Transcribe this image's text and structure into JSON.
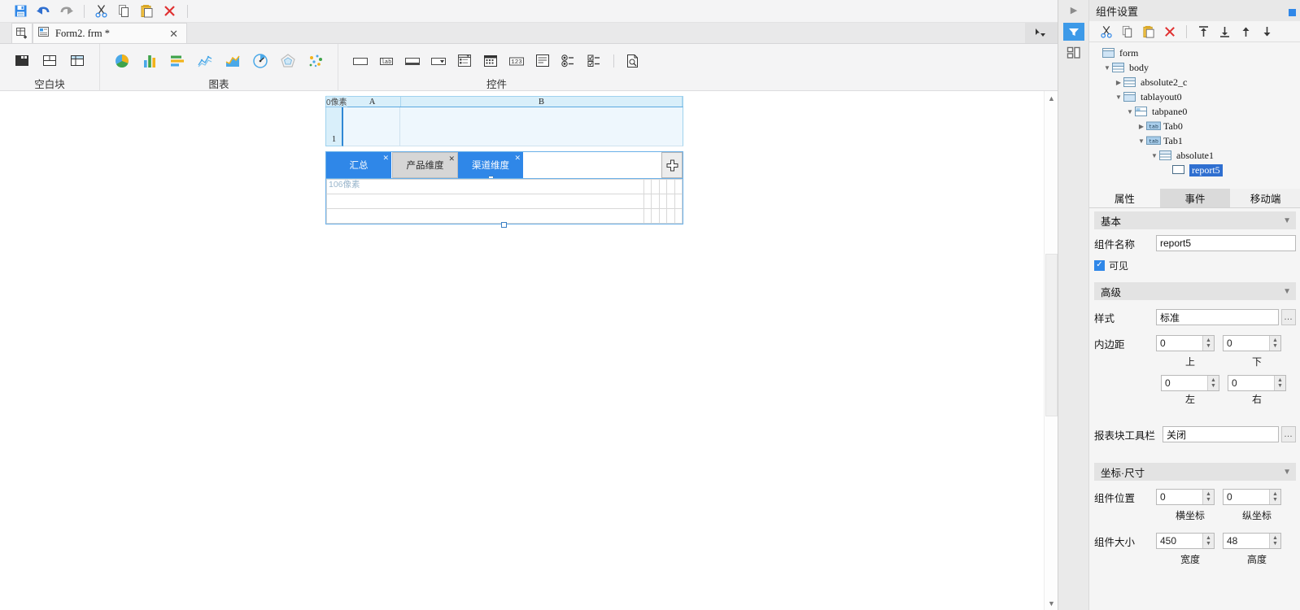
{
  "quick_toolbar": {
    "buttons": [
      {
        "name": "save-button",
        "icon": "save-icon",
        "label": "保存"
      },
      {
        "name": "undo-button",
        "icon": "undo-arrow-icon",
        "label": "撤销"
      },
      {
        "name": "redo-button",
        "icon": "redo-arrow-icon",
        "label": "重做"
      },
      {
        "name": "cut-button",
        "icon": "scissors-icon",
        "label": "剪切"
      },
      {
        "name": "copy-button",
        "icon": "copy-icon",
        "label": "复制"
      },
      {
        "name": "paste-button",
        "icon": "paste-icon",
        "label": "粘贴"
      },
      {
        "name": "delete-button",
        "icon": "red-x-icon",
        "label": "删除"
      }
    ]
  },
  "doc_tabs": {
    "grid_button_icon": "grid-plus-icon",
    "tabs": [
      {
        "label": "Form2. frm *",
        "icon": "form-document-icon",
        "close": "✕",
        "active": true
      }
    ],
    "right_icon": "cursor-dropdown-icon"
  },
  "ribbon": {
    "groups": [
      {
        "title": "空白块",
        "caret": "",
        "icons": [
          {
            "name": "block-solid-icon",
            "label": "空白块"
          },
          {
            "name": "block-split-horizontal-icon",
            "label": "横向分块"
          },
          {
            "name": "block-split-grid-icon",
            "label": "网格分块"
          }
        ]
      },
      {
        "title": "图表",
        "caret": "⌄",
        "icons": [
          {
            "name": "pie-chart-icon",
            "label": "饼图"
          },
          {
            "name": "bar-chart-icon",
            "label": "柱形图"
          },
          {
            "name": "horizontal-bar-chart-icon",
            "label": "条形图"
          },
          {
            "name": "line-chart-icon",
            "label": "折线图"
          },
          {
            "name": "area-chart-icon",
            "label": "面积图"
          },
          {
            "name": "gauge-chart-icon",
            "label": "仪表盘"
          },
          {
            "name": "radar-chart-icon",
            "label": "雷达图"
          },
          {
            "name": "bubble-chart-icon",
            "label": "气泡图"
          }
        ]
      },
      {
        "title": "控件",
        "caret": "⌄",
        "icons": [
          {
            "name": "textbox-control-icon",
            "label": "文本框"
          },
          {
            "name": "label-control-icon",
            "label": "标签"
          },
          {
            "name": "textarea-control-icon",
            "label": "文本域"
          },
          {
            "name": "combobox-control-icon",
            "label": "下拉框"
          },
          {
            "name": "treebox-control-icon",
            "label": "树控件"
          },
          {
            "name": "datepicker-control-icon",
            "label": "日期控件"
          },
          {
            "name": "number-control-icon",
            "label": "数字控件"
          },
          {
            "name": "multiline-control-icon",
            "label": "多行文本"
          },
          {
            "name": "radio-group-control-icon",
            "label": "单选按钮组"
          },
          {
            "name": "checkbox-group-control-icon",
            "label": "复选按钮组"
          },
          {
            "name": "preview-control-icon",
            "label": "预览"
          }
        ]
      }
    ]
  },
  "canvas": {
    "sheet": {
      "pixel_badge": "0像素",
      "columns": [
        "A",
        "B"
      ],
      "rows": [
        "1"
      ]
    },
    "tablayout": {
      "tabs": [
        {
          "label": "汇总",
          "state": "selected",
          "close": "✕"
        },
        {
          "label": "产品维度",
          "state": "normal",
          "close": "✕"
        },
        {
          "label": "渠道维度",
          "state": "selected",
          "close": "✕"
        }
      ],
      "add_tab_icon": "plus-icon",
      "report_grid": {
        "pixel_badge": "106像素",
        "columns": 6,
        "rows": 3
      }
    }
  },
  "scrollbar": {
    "up_arrow": "▲",
    "down_arrow": "▼"
  },
  "right_panel": {
    "rail": {
      "expander": "▶",
      "buttons": [
        {
          "name": "filter-panel-button",
          "icon": "filter-icon",
          "active": true
        },
        {
          "name": "layout-panel-button",
          "icon": "layout-blocks-icon",
          "active": false
        }
      ]
    },
    "title": "组件设置",
    "tree_toolbar": [
      {
        "name": "tree-cut-button",
        "icon": "scissors-icon"
      },
      {
        "name": "tree-copy-button",
        "icon": "copy-icon"
      },
      {
        "name": "tree-paste-button",
        "icon": "paste-icon"
      },
      {
        "name": "tree-delete-button",
        "icon": "red-x-icon"
      },
      {
        "name": "move-to-top-button",
        "icon": "move-top-icon"
      },
      {
        "name": "move-to-bottom-button",
        "icon": "move-bottom-icon"
      },
      {
        "name": "move-up-button",
        "icon": "arrow-up-icon"
      },
      {
        "name": "move-down-button",
        "icon": "arrow-down-icon"
      }
    ],
    "tree": [
      {
        "label": "form",
        "depth": 0,
        "twisty": "",
        "icon": "form-node-icon",
        "selected": false
      },
      {
        "label": "body",
        "depth": 1,
        "twisty": "▼",
        "icon": "body-node-icon",
        "selected": false
      },
      {
        "label": "absolute2_c",
        "depth": 2,
        "twisty": "▶",
        "icon": "absolute-node-icon",
        "selected": false
      },
      {
        "label": "tablayout0",
        "depth": 2,
        "twisty": "▼",
        "icon": "tablayout-node-icon",
        "selected": false
      },
      {
        "label": "tabpane0",
        "depth": 3,
        "twisty": "▼",
        "icon": "tabpane-node-icon",
        "selected": false
      },
      {
        "label": "Tab0",
        "depth": 4,
        "twisty": "▶",
        "icon": "tab-node-icon",
        "selected": false
      },
      {
        "label": "Tab1",
        "depth": 4,
        "twisty": "▼",
        "icon": "tab-node-icon",
        "selected": false
      },
      {
        "label": "absolute1",
        "depth": 5,
        "twisty": "▼",
        "icon": "absolute-node-icon",
        "selected": false
      },
      {
        "label": "report5",
        "depth": 6,
        "twisty": "",
        "icon": "report-node-icon",
        "selected": true
      }
    ],
    "prop_tabs": [
      {
        "label": "属性",
        "active": true
      },
      {
        "label": "事件",
        "active": false
      },
      {
        "label": "移动端",
        "active": false
      }
    ],
    "sections": {
      "basic": {
        "title": "基本",
        "caret": "▼",
        "name_label": "组件名称",
        "name_value": "report5",
        "visible_label": "可见",
        "visible_checked": true,
        "check_glyph": "✓"
      },
      "advanced": {
        "title": "高级",
        "caret": "▼",
        "style_label": "样式",
        "style_value": "标准",
        "style_dots": "…",
        "padding_label": "内边距",
        "padding_top": "0",
        "padding_bottom": "0",
        "padding_left": "0",
        "padding_right": "0",
        "sub_top": "上",
        "sub_bottom": "下",
        "sub_left": "左",
        "sub_right": "右",
        "toolbar_label": "报表块工具栏",
        "toolbar_value": "关闭",
        "toolbar_dots": "…"
      },
      "geometry": {
        "title": "坐标·尺寸",
        "caret": "▼",
        "position_label": "组件位置",
        "position_x": "0",
        "position_y": "0",
        "sub_x": "横坐标",
        "sub_y": "纵坐标",
        "size_label": "组件大小",
        "size_w": "450",
        "size_h": "48",
        "sub_w": "宽度",
        "sub_h": "高度"
      }
    }
  },
  "colors": {
    "accent_blue": "#2f87e8",
    "tree_select": "#2f6fd0",
    "sheet_header": "#d9effa",
    "panel_bg": "#f5f5f5"
  }
}
